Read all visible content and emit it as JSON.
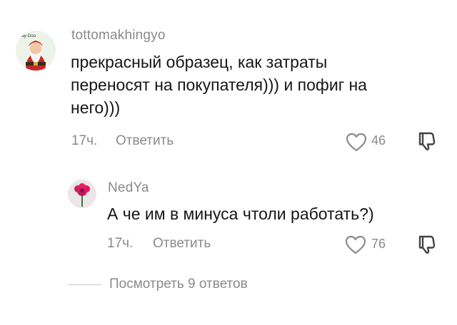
{
  "comments": [
    {
      "author": "tottomakhingyo",
      "avatar_icon": "santa-avatar",
      "avatar_text": "Hay-Goo",
      "text": "прекрасный образец, как затраты переносят на покупателя))) и пофиг на него)))",
      "time": "17ч.",
      "reply_label": "Ответить",
      "likes": "46"
    },
    {
      "author": "NedYa",
      "avatar_icon": "flower-avatar",
      "text": "А че им в минуса чтоли работать?)",
      "time": "17ч.",
      "reply_label": "Ответить",
      "likes": "76"
    }
  ],
  "view_replies": "Посмотреть 9 ответов",
  "colors": {
    "secondary_text": "#8a8a8a",
    "primary_text": "#161616",
    "avatar_flower": "#c2185b"
  }
}
